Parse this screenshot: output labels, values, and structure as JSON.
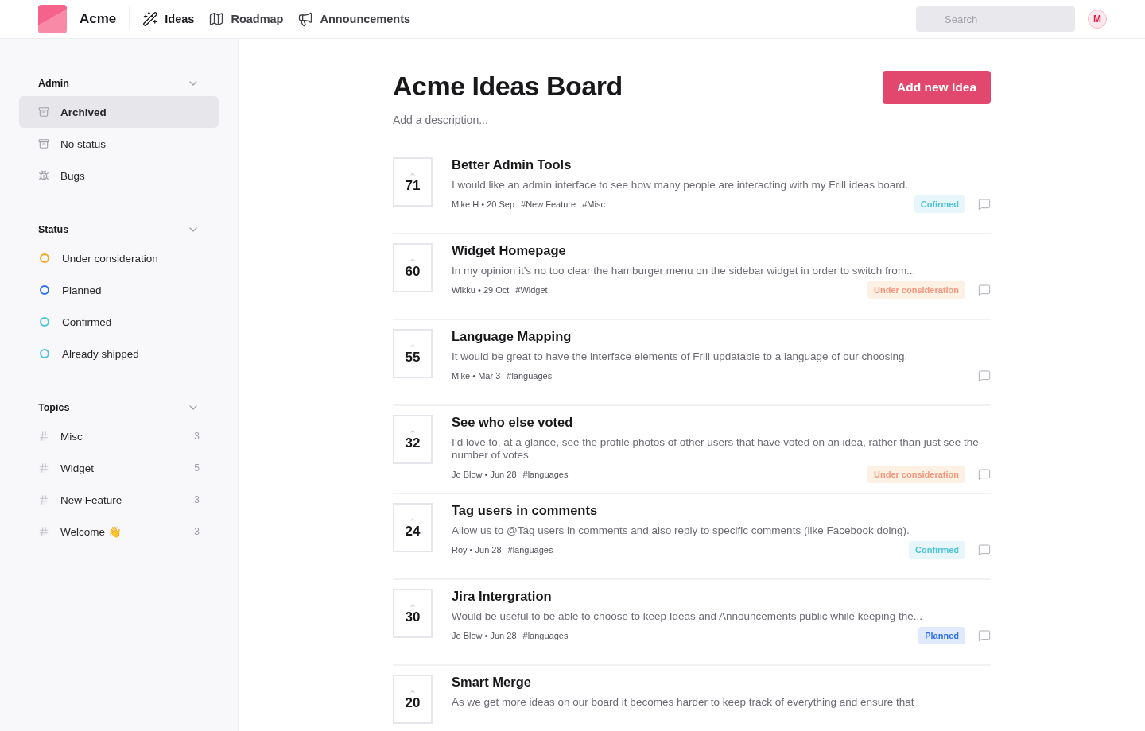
{
  "header": {
    "brand": "Acme",
    "nav": [
      {
        "label": "Ideas",
        "kind": "wand",
        "selected": true
      },
      {
        "label": "Roadmap",
        "kind": "map",
        "selected": false
      },
      {
        "label": "Announcements",
        "kind": "megaphone",
        "selected": false
      }
    ],
    "search": {
      "placeholder": "Search"
    },
    "avatar": "M"
  },
  "sidebar": {
    "sections": [
      {
        "title": "Admin",
        "expanded": true,
        "items": [
          {
            "label": "Archived",
            "kind": "archive",
            "selected": true
          },
          {
            "label": "No status",
            "kind": "archive",
            "selected": false
          },
          {
            "label": "Bugs",
            "kind": "bug",
            "selected": false
          }
        ]
      },
      {
        "title": "Status",
        "expanded": true,
        "items": [
          {
            "label": "Under consideration",
            "kind": "status",
            "color": "#f5a623",
            "selected": false
          },
          {
            "label": "Planned",
            "kind": "status",
            "color": "#2f6fed",
            "selected": false
          },
          {
            "label": "Confirmed",
            "kind": "status",
            "color": "#4fc3d9",
            "selected": false
          },
          {
            "label": "Already shipped",
            "kind": "status",
            "color": "#4fc3d9",
            "selected": false
          }
        ]
      },
      {
        "title": "Topics",
        "expanded": true,
        "items": [
          {
            "label": "Misc",
            "kind": "topic",
            "count": "3",
            "selected": false
          },
          {
            "label": "Widget",
            "kind": "topic",
            "count": "5",
            "selected": false
          },
          {
            "label": "New Feature",
            "kind": "topic",
            "count": "3",
            "selected": false
          },
          {
            "label": "Welcome 👋",
            "kind": "topic",
            "count": "3",
            "selected": false
          }
        ]
      }
    ]
  },
  "board": {
    "title": "Acme Ideas Board",
    "description": "Add a description...",
    "add_button": "Add new Idea"
  },
  "ideas": [
    {
      "votes": "71",
      "title": "Better Admin Tools",
      "body": "I would like an admin interface to see how many people are interacting with my Frill ideas board.",
      "byline": "Mike H • 20 Sep",
      "tags": [
        "#New Feature",
        "#Misc"
      ],
      "status": {
        "kind": "confirmed",
        "label": "Cofirmed"
      }
    },
    {
      "votes": "60",
      "title": "Widget Homepage",
      "body": "In my opinion it's no too clear the hamburger menu on the sidebar widget in order to switch from...",
      "byline": "Wikku • 29 Oct",
      "tags": [
        "#Widget"
      ],
      "status": {
        "kind": "consideration",
        "label": "Under consideration"
      }
    },
    {
      "votes": "55",
      "title": "Language Mapping",
      "body": "It would be great to have the interface elements of Frill updatable to a language of our choosing.",
      "byline": "Mike • Mar 3",
      "tags": [
        "#languages"
      ]
    },
    {
      "votes": "32",
      "title": "See who else voted",
      "body": "I’d love to, at a glance, see the profile photos of other users that have voted on an idea, rather than just see the number of votes.",
      "byline": "Jo Blow • Jun 28",
      "tags": [
        "#languages"
      ],
      "status": {
        "kind": "consideration",
        "label": "Under consideration"
      }
    },
    {
      "votes": "24",
      "title": "Tag users in comments",
      "body": "Allow us to @Tag users in comments and also reply to specific comments (like Facebook doing).",
      "byline": "Roy • Jun 28",
      "tags": [
        "#languages"
      ],
      "status": {
        "kind": "confirmed",
        "label": "Confirmed"
      }
    },
    {
      "votes": "30",
      "title": "Jira Intergration",
      "body": "Would be useful to be able to choose to keep Ideas and Announcements public while keeping the...",
      "byline": "Jo Blow • Jun 28",
      "tags": [
        "#languages"
      ],
      "status": {
        "kind": "planned",
        "label": "Planned"
      }
    },
    {
      "votes": "20",
      "title": "Smart Merge",
      "body": "As we get more ideas on our board it becomes harder to keep track of everything and ensure that"
    }
  ]
}
